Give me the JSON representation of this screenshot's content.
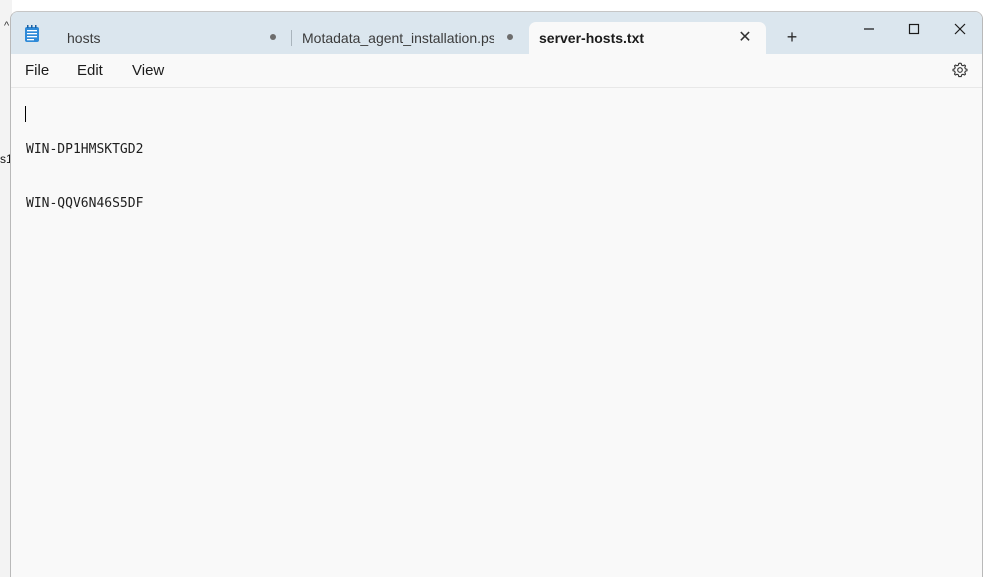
{
  "background": {
    "fragment_text": "s1"
  },
  "tabs": [
    {
      "label": "hosts",
      "active": false,
      "modified": true
    },
    {
      "label": "Motadata_agent_installation.ps",
      "active": false,
      "modified": true
    },
    {
      "label": "server-hosts.txt",
      "active": true,
      "modified": false
    }
  ],
  "icons": {
    "app": "notepad-icon",
    "new_tab": "plus-icon",
    "close_tab": "close-icon",
    "minimize": "minimize-icon",
    "maximize": "maximize-icon",
    "close": "close-window-icon",
    "settings": "gear-icon"
  },
  "menu": {
    "file": "File",
    "edit": "Edit",
    "view": "View"
  },
  "editor": {
    "lines": [
      "WIN-DP1HMSKTGD2",
      "WIN-QQV6N46S5DF"
    ]
  },
  "colors": {
    "titlebar": "#dbe6ee",
    "editor_background": "#f9f9f9",
    "active_tab": "#f9f9f9"
  }
}
